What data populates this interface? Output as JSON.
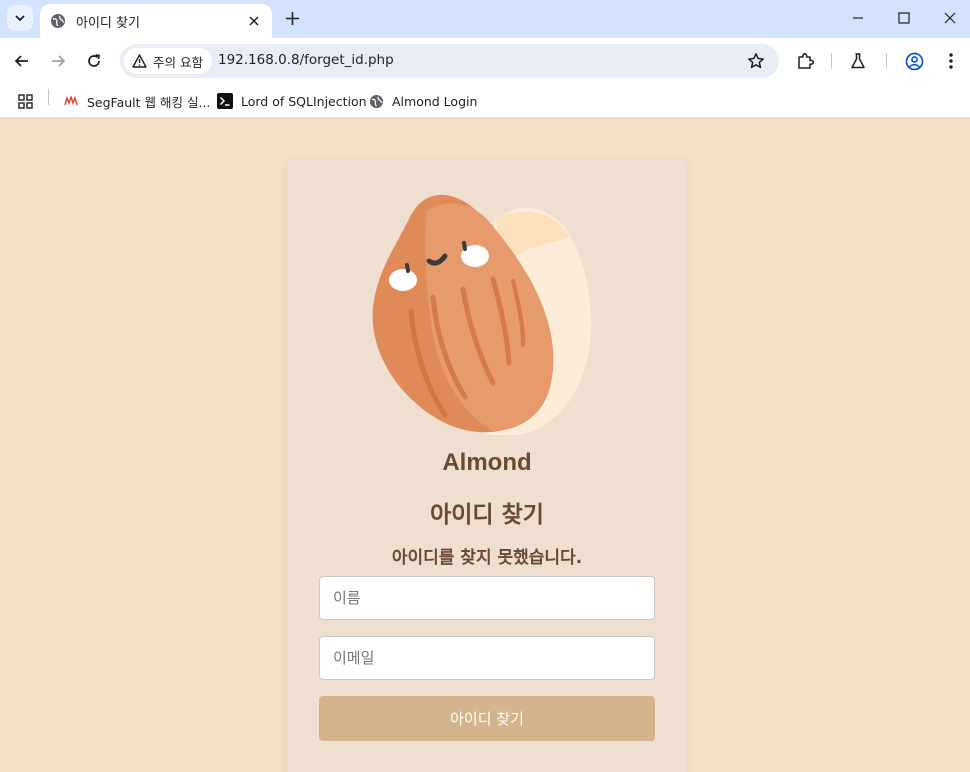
{
  "browser": {
    "tab_title": "아이디 찾기",
    "security_label": "주의 요함",
    "url": "192.168.0.8/forget_id.php",
    "bookmarks": [
      {
        "label": "SegFault 웹 해킹 실...",
        "icon": "segfault-icon"
      },
      {
        "label": "Lord of SQLInjection",
        "icon": "terminal-icon"
      },
      {
        "label": "Almond Login",
        "icon": "globe-icon"
      }
    ]
  },
  "page": {
    "brand": "Almond",
    "heading": "아이디 찾기",
    "message": "아이디를 찾지 못했습니다.",
    "name_placeholder": "이름",
    "email_placeholder": "이메일",
    "submit_label": "아이디 찾기"
  },
  "colors": {
    "page_bg": "#f5e0c6",
    "card_bg": "#eedfd0",
    "text_brown": "#6b4a33",
    "button_bg": "#d4b48c"
  }
}
